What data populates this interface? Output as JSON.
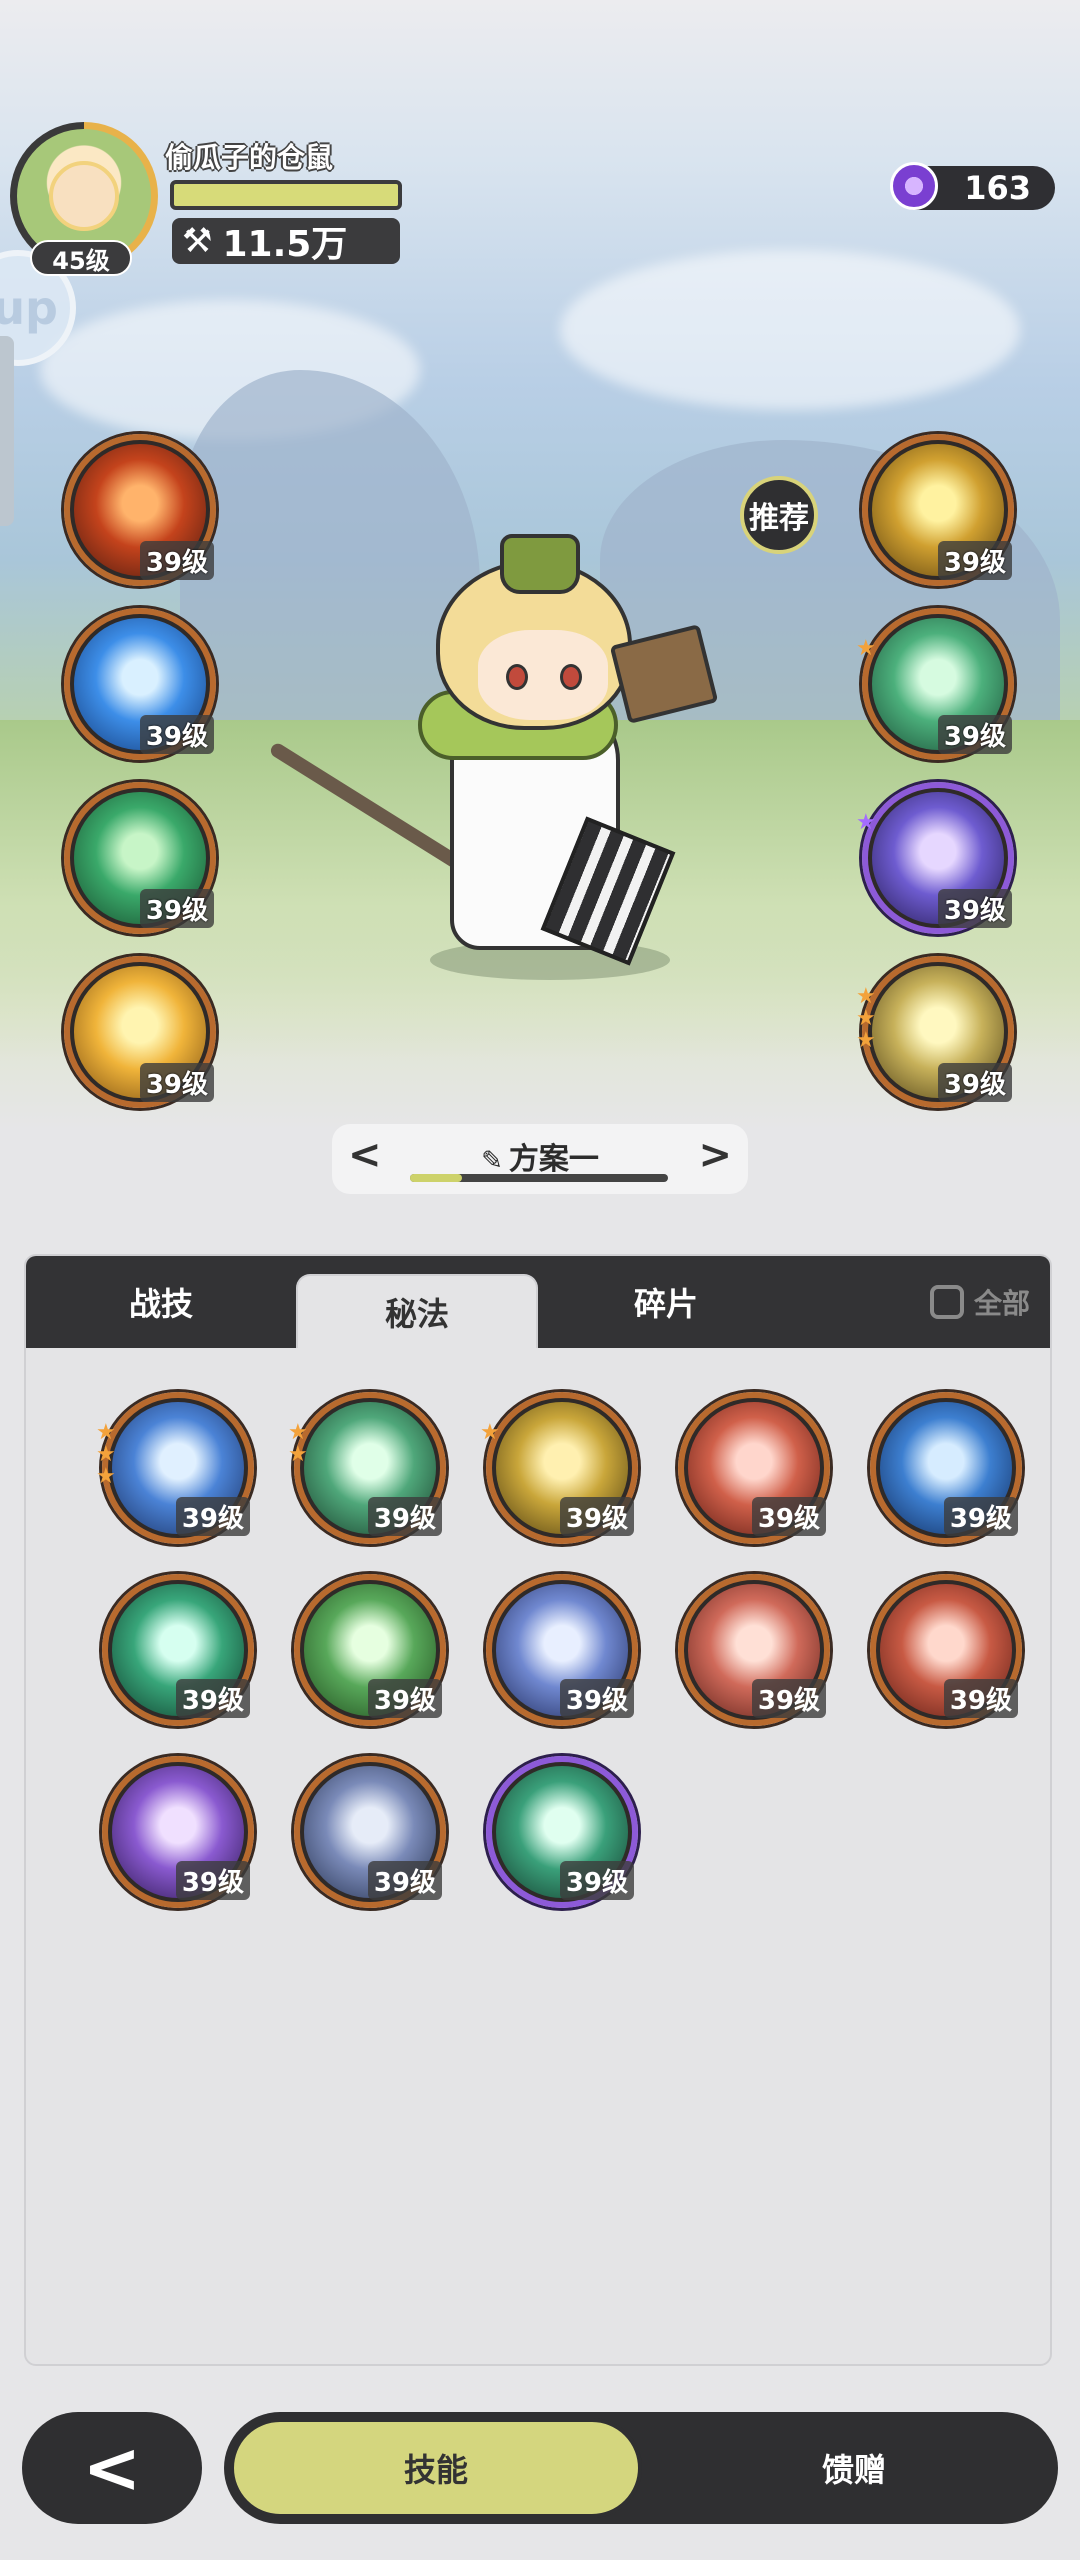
{
  "player": {
    "name": "偷瓜子的仓鼠",
    "level": "45级",
    "power": "11.5万"
  },
  "currency": {
    "amount": "163"
  },
  "side_tab": {
    "label": "up"
  },
  "recommend_label": "推荐",
  "equipped_left": [
    {
      "level": "39级",
      "colors": [
        "#ffb36b",
        "#c4431c",
        "#4a1a10"
      ]
    },
    {
      "level": "39级",
      "colors": [
        "#d9f0ff",
        "#3d8ee8",
        "#143b7a"
      ]
    },
    {
      "level": "39级",
      "colors": [
        "#c7f5c7",
        "#3aa96a",
        "#164a2c"
      ]
    },
    {
      "level": "39级",
      "colors": [
        "#fff4b0",
        "#f0b43a",
        "#7a4d12"
      ]
    }
  ],
  "equipped_right": [
    {
      "level": "39级",
      "colors": [
        "#fff2a0",
        "#d0a030",
        "#5a4010"
      ],
      "stars": 0
    },
    {
      "level": "39级",
      "colors": [
        "#d6fbe0",
        "#4cb07c",
        "#1a4d36"
      ],
      "stars": 1
    },
    {
      "level": "39级",
      "colors": [
        "#e6d7ff",
        "#6e5cd0",
        "#241a50"
      ],
      "stars": 1,
      "purple": true
    },
    {
      "level": "39级",
      "colors": [
        "#fff8c0",
        "#c7b15a",
        "#4d3f16"
      ],
      "stars": 3
    }
  ],
  "preset": {
    "name": "方案一",
    "prev": "<",
    "next": ">"
  },
  "tabs": [
    "战技",
    "秘法",
    "碎片"
  ],
  "active_tab": 1,
  "filter_label": "全部",
  "skills": [
    {
      "level": "39级",
      "colors": [
        "#e0f0ff",
        "#4b83d6",
        "#1a2f60"
      ],
      "stars": 3
    },
    {
      "level": "39级",
      "colors": [
        "#e0ffe8",
        "#4fa77a",
        "#183d2a"
      ],
      "stars": 2
    },
    {
      "level": "39级",
      "colors": [
        "#fff0b0",
        "#c9a63a",
        "#4a3a10"
      ],
      "stars": 1
    },
    {
      "level": "39级",
      "colors": [
        "#ffd6cc",
        "#d0604a",
        "#5a1a12"
      ],
      "stars": 0
    },
    {
      "level": "39级",
      "colors": [
        "#d6ecff",
        "#3d7fd0",
        "#102a5a"
      ],
      "stars": 0
    },
    {
      "level": "39级",
      "colors": [
        "#d6fff0",
        "#38a67a",
        "#0f3a2a"
      ],
      "stars": 0
    },
    {
      "level": "39级",
      "colors": [
        "#e6ffe0",
        "#58a85a",
        "#1f4a1c"
      ],
      "stars": 0
    },
    {
      "level": "39级",
      "colors": [
        "#e8efff",
        "#7088d0",
        "#1f2a5a"
      ],
      "stars": 0
    },
    {
      "level": "39级",
      "colors": [
        "#ffe0d6",
        "#d06a5a",
        "#5a1f18"
      ],
      "stars": 0
    },
    {
      "level": "39级",
      "colors": [
        "#ffd8cc",
        "#c85a44",
        "#5a1c14"
      ],
      "stars": 0
    },
    {
      "level": "39级",
      "colors": [
        "#f0e0ff",
        "#8a5ad0",
        "#2a164d"
      ],
      "stars": 0
    },
    {
      "level": "39级",
      "colors": [
        "#e6ecf8",
        "#7a8ab8",
        "#24304d"
      ],
      "stars": 0
    },
    {
      "level": "39级",
      "colors": [
        "#e0fff0",
        "#3aa07a",
        "#143a2c"
      ],
      "stars": 0,
      "purple": true
    }
  ],
  "bottom_nav": {
    "back": "<",
    "items": [
      "技能",
      "馈赠"
    ]
  }
}
